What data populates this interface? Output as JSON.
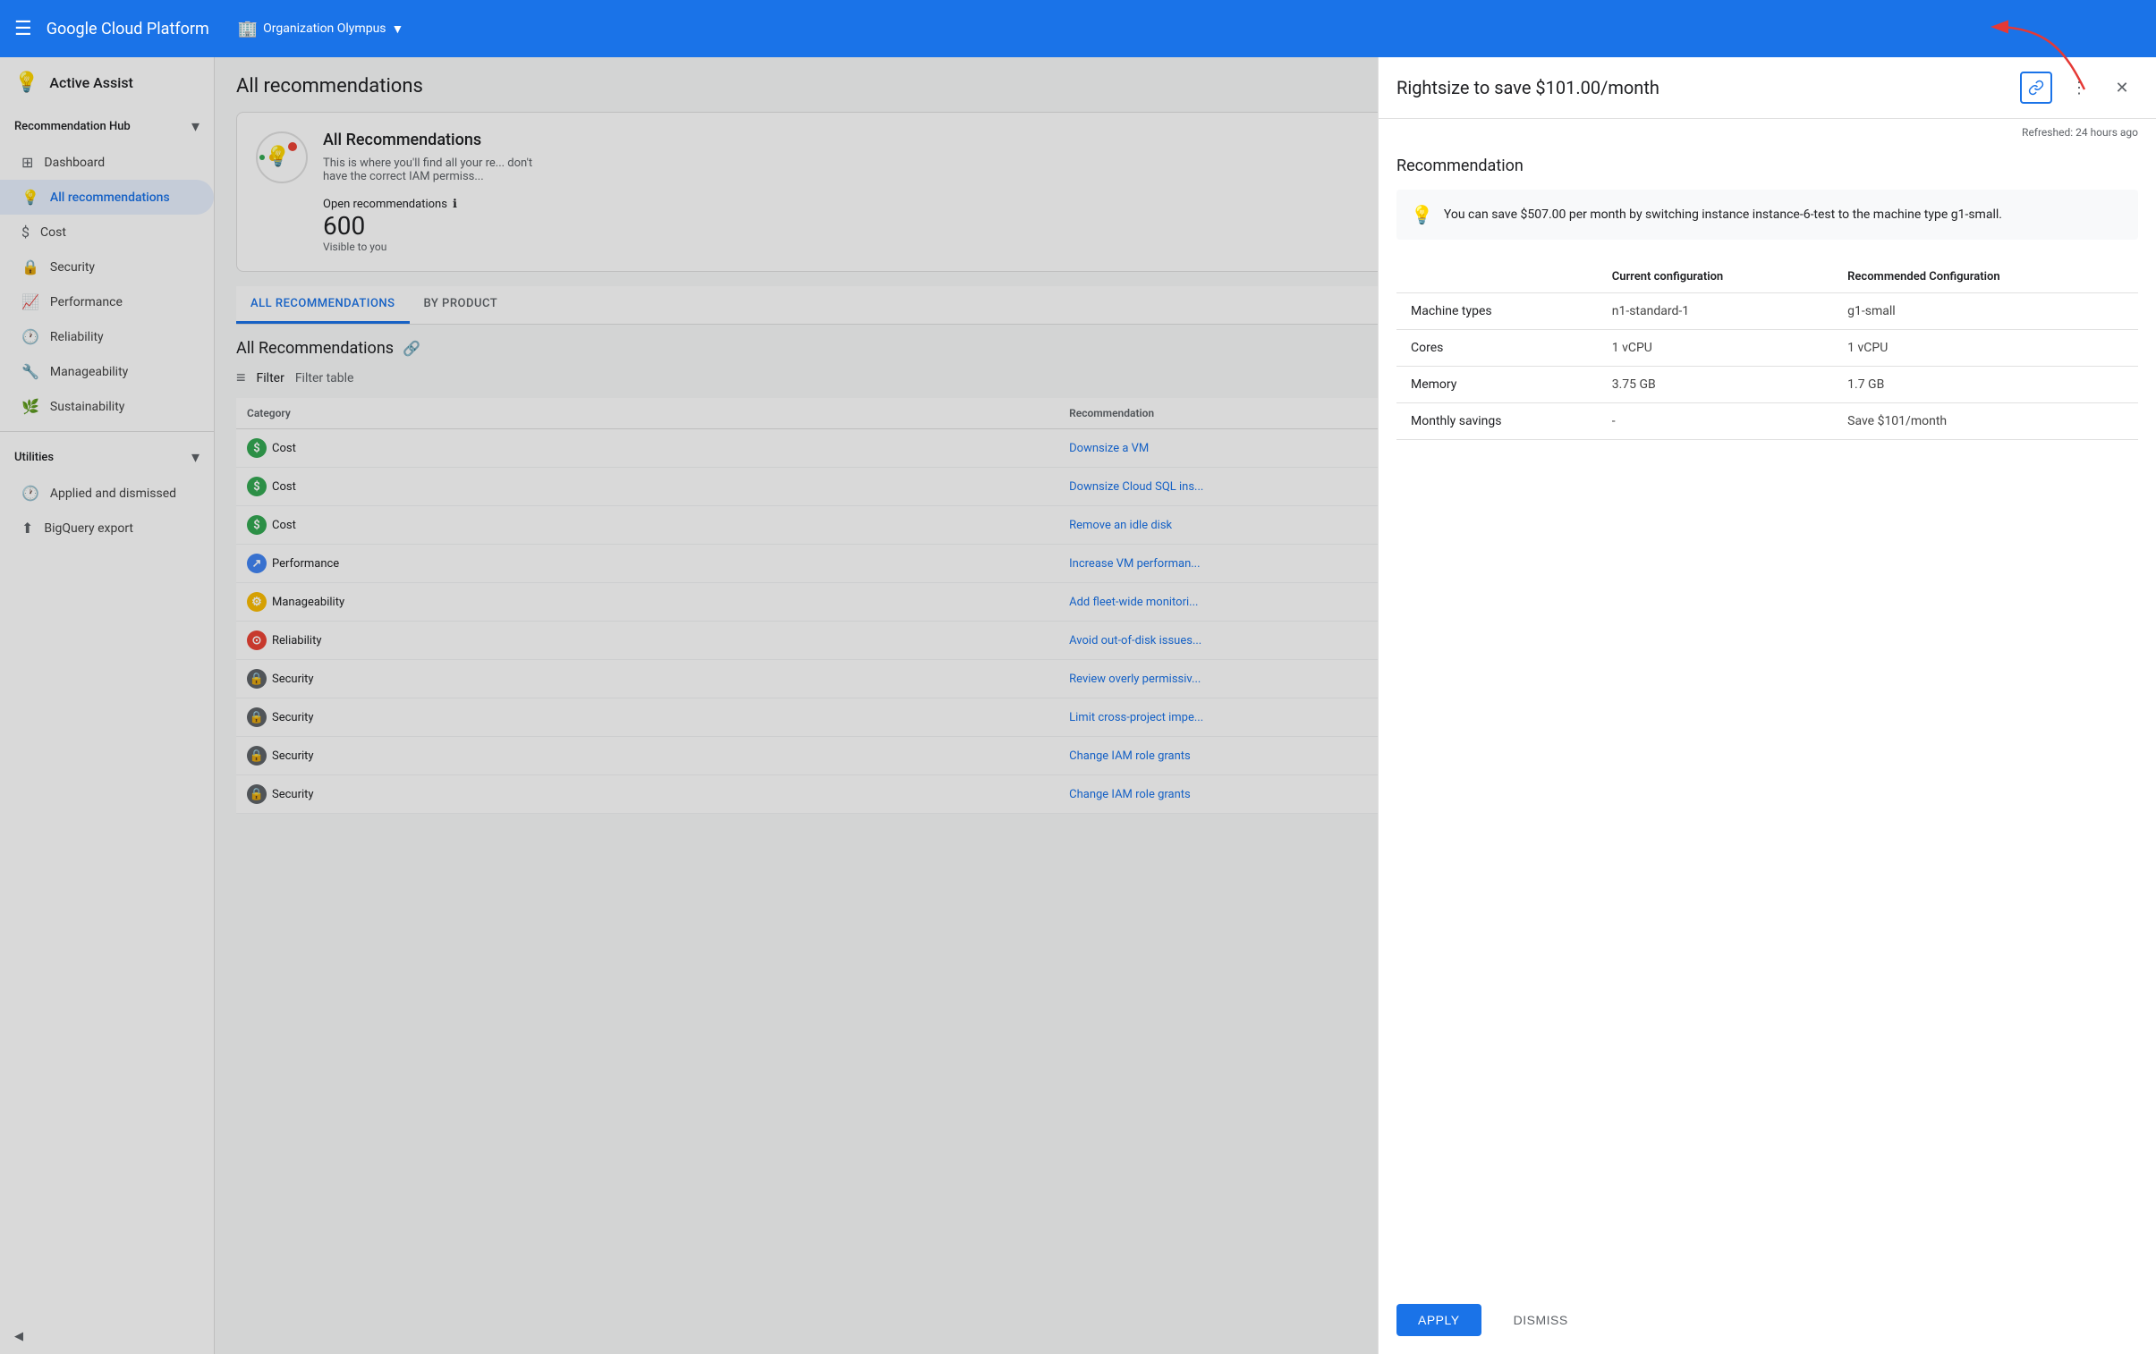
{
  "topbar": {
    "hamburger_icon": "☰",
    "logo": "Google Cloud Platform",
    "org_icon": "🏢",
    "org_name": "Organization Olympus",
    "org_chevron": "▼"
  },
  "sidebar": {
    "active_assist_icon": "💡",
    "active_assist_label": "Active Assist",
    "recommendation_hub_label": "Recommendation Hub",
    "recommendation_hub_chevron": "▾",
    "items": [
      {
        "id": "dashboard",
        "icon": "⊞",
        "label": "Dashboard",
        "active": false
      },
      {
        "id": "all-recommendations",
        "icon": "💡",
        "label": "All recommendations",
        "active": true
      },
      {
        "id": "cost",
        "icon": "$",
        "label": "Cost",
        "active": false
      },
      {
        "id": "security",
        "icon": "🔒",
        "label": "Security",
        "active": false
      },
      {
        "id": "performance",
        "icon": "📈",
        "label": "Performance",
        "active": false
      },
      {
        "id": "reliability",
        "icon": "🕐",
        "label": "Reliability",
        "active": false
      },
      {
        "id": "manageability",
        "icon": "🔧",
        "label": "Manageability",
        "active": false
      },
      {
        "id": "sustainability",
        "icon": "🌿",
        "label": "Sustainability",
        "active": false
      }
    ],
    "utilities_label": "Utilities",
    "utilities_chevron": "▾",
    "utility_items": [
      {
        "id": "applied-dismissed",
        "icon": "🕐",
        "label": "Applied and dismissed"
      },
      {
        "id": "bigquery-export",
        "icon": "⬆",
        "label": "BigQuery export"
      }
    ],
    "collapse_icon": "◀"
  },
  "main": {
    "header": "All recommendations",
    "info_box": {
      "icon_char": "💡",
      "title": "All Recommendations",
      "description": "This is where you'll find all your re... don't have the correct IAM permiss..."
    },
    "open_recommendations": {
      "label": "Open recommendations",
      "info_icon": "ℹ",
      "count": "600",
      "visible": "Visible to you"
    },
    "tabs": [
      {
        "id": "all",
        "label": "ALL RECOMMENDATIONS",
        "active": true
      },
      {
        "id": "by-product",
        "label": "BY PRODUCT",
        "active": false
      }
    ],
    "all_reco_section_title": "All Recommendations",
    "link_icon": "🔗",
    "filter_label": "Filter",
    "filter_table_label": "Filter table",
    "table_headers": [
      "Category",
      "Recommendation"
    ],
    "table_rows": [
      {
        "category": "Cost",
        "badge": "cost",
        "recommendation": "Downsize a VM"
      },
      {
        "category": "Cost",
        "badge": "cost",
        "recommendation": "Downsize Cloud SQL ins..."
      },
      {
        "category": "Cost",
        "badge": "cost",
        "recommendation": "Remove an idle disk"
      },
      {
        "category": "Performance",
        "badge": "performance",
        "recommendation": "Increase VM performan..."
      },
      {
        "category": "Manageability",
        "badge": "manageability",
        "recommendation": "Add fleet-wide monitori..."
      },
      {
        "category": "Reliability",
        "badge": "reliability",
        "recommendation": "Avoid out-of-disk issues..."
      },
      {
        "category": "Security",
        "badge": "security",
        "recommendation": "Review overly permissiv..."
      },
      {
        "category": "Security",
        "badge": "security",
        "recommendation": "Limit cross-project impe..."
      },
      {
        "category": "Security",
        "badge": "security",
        "recommendation": "Change IAM role grants"
      },
      {
        "category": "Security",
        "badge": "security",
        "recommendation": "Change IAM role grants"
      }
    ]
  },
  "detail_panel": {
    "title": "Rightsize to save $101.00/month",
    "link_btn_icon": "🔗",
    "more_icon": "⋮",
    "close_icon": "✕",
    "refreshed_label": "Refreshed: 24 hours ago",
    "section_title": "Recommendation",
    "info_text": "You can save $507.00 per month by switching instance instance-6-test to the machine type g1-small.",
    "info_icon": "💡",
    "table": {
      "col1": "",
      "col2": "Current configuration",
      "col3": "Recommended Configuration",
      "rows": [
        {
          "label": "Machine types",
          "current": "n1-standard-1",
          "recommended": "g1-small"
        },
        {
          "label": "Cores",
          "current": "1 vCPU",
          "recommended": "1 vCPU"
        },
        {
          "label": "Memory",
          "current": "3.75 GB",
          "recommended": "1.7 GB"
        },
        {
          "label": "Monthly savings",
          "current": "-",
          "recommended": "Save $101/month"
        }
      ]
    },
    "apply_label": "APPLY",
    "dismiss_label": "DISMISS"
  },
  "arrow_annotation": {
    "visible": true
  }
}
